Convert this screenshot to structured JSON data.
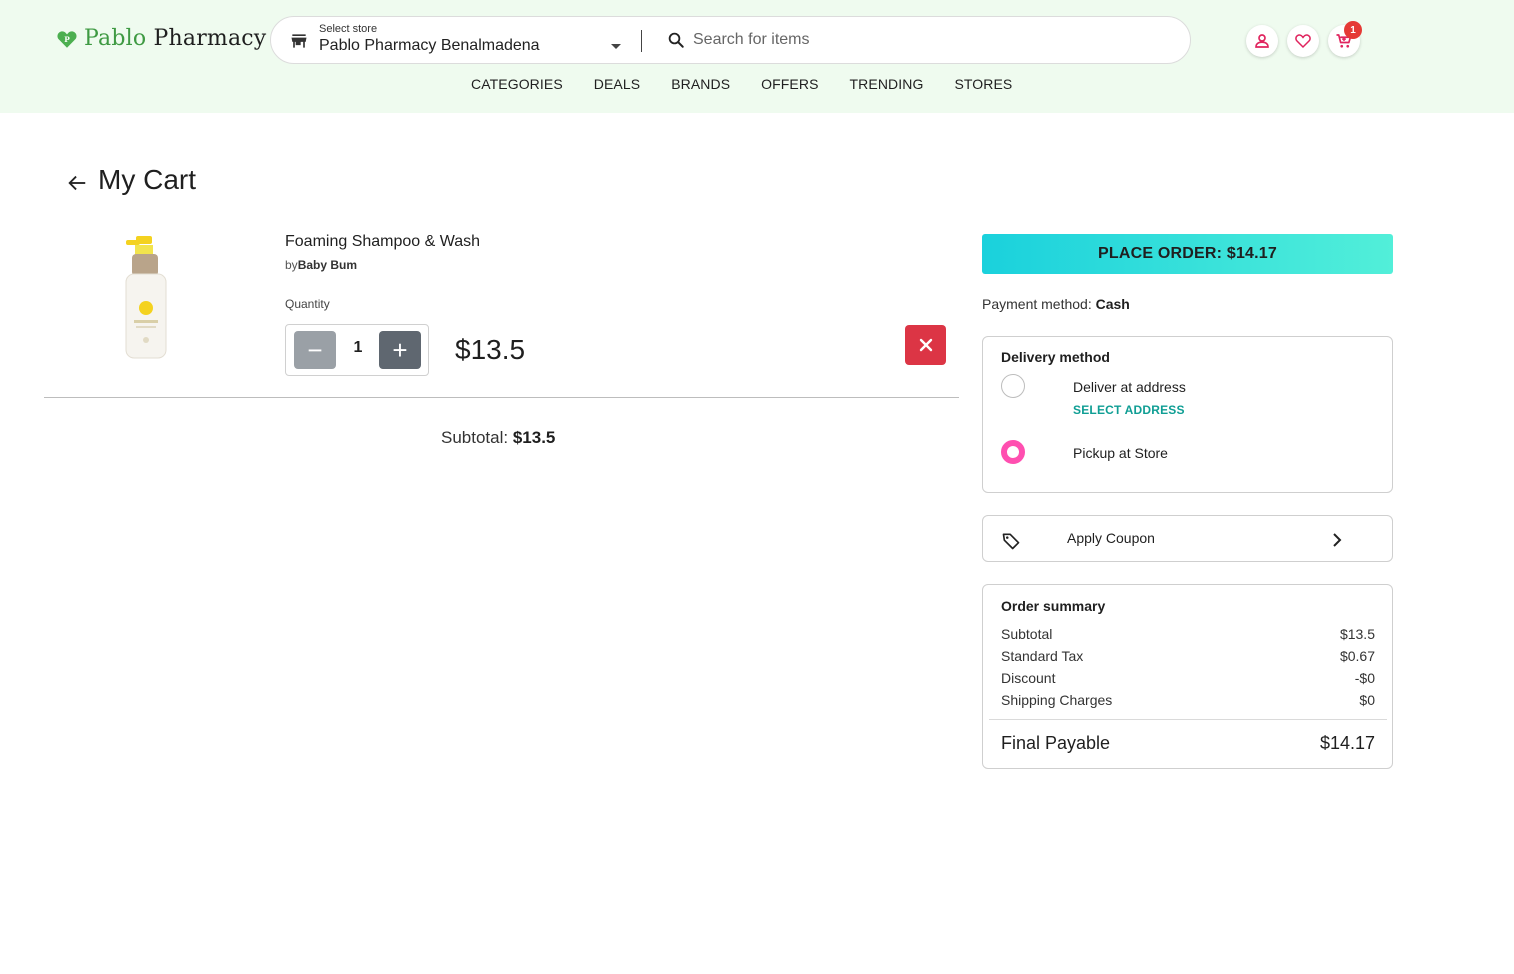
{
  "brand": {
    "name_part1": "Pablo",
    "name_part2": "Pharmacy",
    "color": "#3f9a43"
  },
  "header": {
    "store_label": "Select store",
    "store_name": "Pablo Pharmacy Benalmadena",
    "search_placeholder": "Search for items",
    "cart_count": "1",
    "icons": [
      "store-icon",
      "search-icon",
      "user-icon",
      "heart-icon",
      "cart-icon"
    ]
  },
  "nav": [
    "CATEGORIES",
    "DEALS",
    "BRANDS",
    "OFFERS",
    "TRENDING",
    "STORES"
  ],
  "page": {
    "title": "My Cart"
  },
  "cart_item": {
    "name": "Foaming Shampoo & Wash",
    "by": "by",
    "brand": "Baby Bum",
    "quantity_label": "Quantity",
    "quantity": "1",
    "minus": "−",
    "plus": "+",
    "price": "$13.5"
  },
  "cart_subtotal": {
    "label": "Subtotal: ",
    "value": "$13.5"
  },
  "place_order": {
    "label": "PLACE ORDER: $14.17"
  },
  "payment": {
    "label": "Payment method: ",
    "value": "Cash"
  },
  "delivery": {
    "title": "Delivery method",
    "option1": "Deliver at address",
    "select_address": "SELECT ADDRESS",
    "option2": "Pickup at Store",
    "selected": "Pickup at Store"
  },
  "coupon": {
    "label": "Apply Coupon"
  },
  "summary": {
    "title": "Order summary",
    "rows": [
      {
        "label": "Subtotal",
        "value": "$13.5"
      },
      {
        "label": "Standard Tax",
        "value": "$0.67"
      },
      {
        "label": "Discount",
        "value": "-$0"
      },
      {
        "label": "Shipping Charges",
        "value": "$0"
      }
    ],
    "final_label": "Final Payable",
    "final_value": "$14.17"
  },
  "colors": {
    "header_bg": "#effbef",
    "accent_pink": "#ff4fb0",
    "remove_red": "#dc3545",
    "teal_link": "#0f9e94",
    "order_gradient_start": "#1ad1dc",
    "order_gradient_end": "#52efd9"
  }
}
